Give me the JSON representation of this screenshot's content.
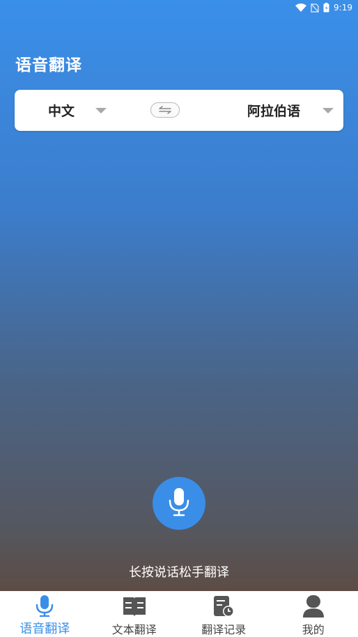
{
  "status_bar": {
    "time": "9:19"
  },
  "header": {
    "title": "语音翻译"
  },
  "language_selector": {
    "source": "中文",
    "target": "阿拉伯语"
  },
  "record": {
    "hint": "长按说话松手翻译"
  },
  "bottom_nav": {
    "items": [
      {
        "label": "语音翻译",
        "icon": "microphone-icon",
        "active": true
      },
      {
        "label": "文本翻译",
        "icon": "book-icon",
        "active": false
      },
      {
        "label": "翻译记录",
        "icon": "history-icon",
        "active": false
      },
      {
        "label": "我的",
        "icon": "profile-icon",
        "active": false
      }
    ]
  },
  "colors": {
    "accent": "#3a8ee8",
    "inactive_icon": "#555555"
  }
}
